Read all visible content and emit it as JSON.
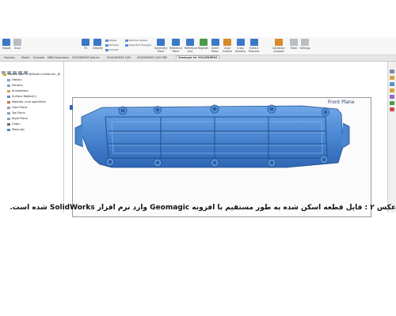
{
  "ribbon": {
    "import_label": "Import",
    "scan_label": "Scan",
    "fit_label": "Fit",
    "simplify_label": "Simplify",
    "repair_label": "Repair",
    "remesh_label": "Remesh",
    "smooth_label": "Smooth",
    "remove_spikes_label": "Remove Spikes",
    "detected_triangles_label": "Detected Triangles",
    "symmetry_plane_label": "Symmetry Plane",
    "reference_plane_label": "Reference Plane",
    "reference_line_label": "Reference Line",
    "register_label": "Register",
    "orient_mesh_label": "Orient Mesh",
    "auto_surface_label": "Auto Surface",
    "cross_sections_label": "Cross Sections",
    "extract_features_label": "Extract Features",
    "deviation_analysis_label": "Deviation Analysis",
    "more_label": "More",
    "settings_label": "Settings"
  },
  "tabs": [
    {
      "label": "Features"
    },
    {
      "label": "Sketch"
    },
    {
      "label": "Evaluate"
    },
    {
      "label": "MBD Dimensions"
    },
    {
      "label": "SOLIDWORKS Add-Ins"
    },
    {
      "label": "SOLIDWORKS CAM"
    },
    {
      "label": "SOLIDWORKS CAM TBM"
    },
    {
      "label": "Geomagic for SOLIDWORKS"
    }
  ],
  "tree": {
    "items": [
      {
        "label": "Pooshe part 3 (Default<<Default>_Di"
      },
      {
        "label": "History"
      },
      {
        "label": "Sensors"
      },
      {
        "label": "Annotations"
      },
      {
        "label": "Surface Bodies(1)"
      },
      {
        "label": "Material <not specified>"
      },
      {
        "label": "Front Plane"
      },
      {
        "label": "Top Plane"
      },
      {
        "label": "Right Plane"
      },
      {
        "label": "Origin"
      },
      {
        "label": "Mesh.stp"
      }
    ]
  },
  "viewport": {
    "plane_label": "Front Plane",
    "part_color": "#4a8ad6"
  },
  "caption": {
    "text": "عکس ۲ : فایل قطعه اسکن شده به طور مستقیم با افزونه Geomagic وارد نرم افزار SolidWorks شده است."
  }
}
